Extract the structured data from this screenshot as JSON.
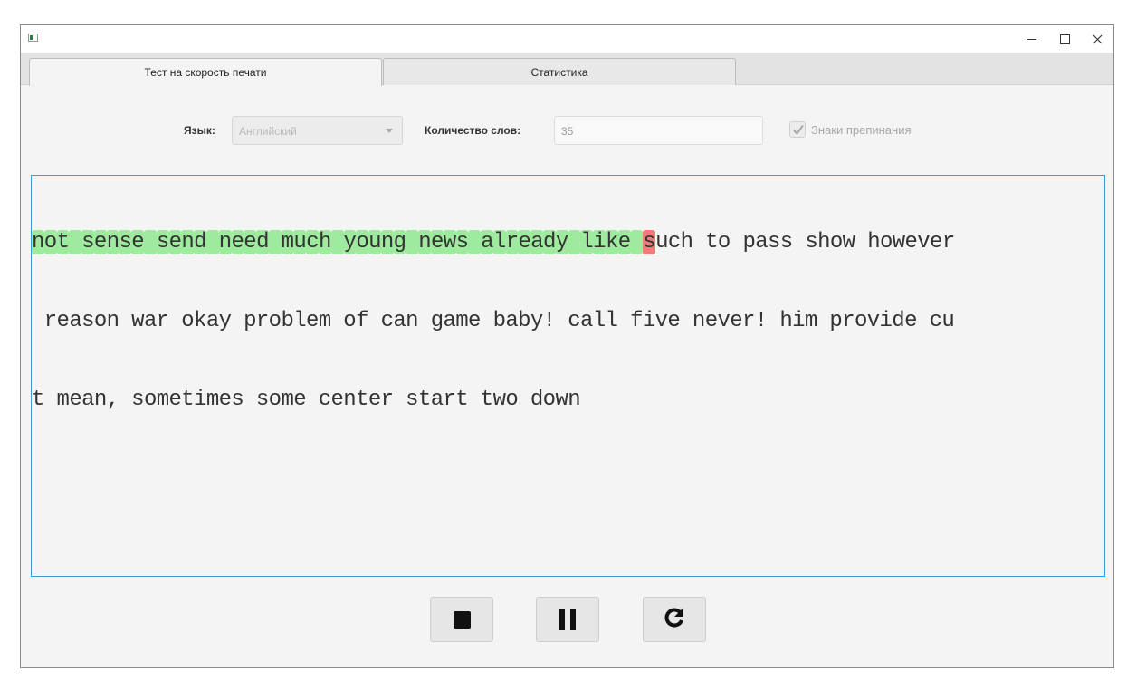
{
  "window": {
    "controls": {
      "minimize": "–",
      "maximize": "☐",
      "close": "✕"
    }
  },
  "tabs": [
    {
      "label": "Тест на скорость печати",
      "active": true
    },
    {
      "label": "Статистика",
      "active": false
    }
  ],
  "settings": {
    "language_label": "Язык:",
    "language_value": "Английский",
    "word_count_label": "Количество слов:",
    "word_count_value": "35",
    "punctuation_label": "Знаки препинания",
    "punctuation_checked": true
  },
  "text": {
    "lines": [
      "not sense send need much young news already like such to pass show however",
      " reason war okay problem of can game baby! call five never! him provide cu",
      "t mean, sometimes some center start two down"
    ],
    "typed_correct": "not sense send need much young news already like ",
    "typed_error": "s",
    "remaining_line1": "uch to pass show however",
    "correct_color": "#9eea9e",
    "error_color": "#ef7b7b"
  },
  "buttons": {
    "stop_icon": "stop-icon",
    "pause_icon": "pause-icon",
    "restart_icon": "restart-icon"
  },
  "colors": {
    "text_area_border": "#3c9bd8",
    "background": "#f4f4f4"
  }
}
